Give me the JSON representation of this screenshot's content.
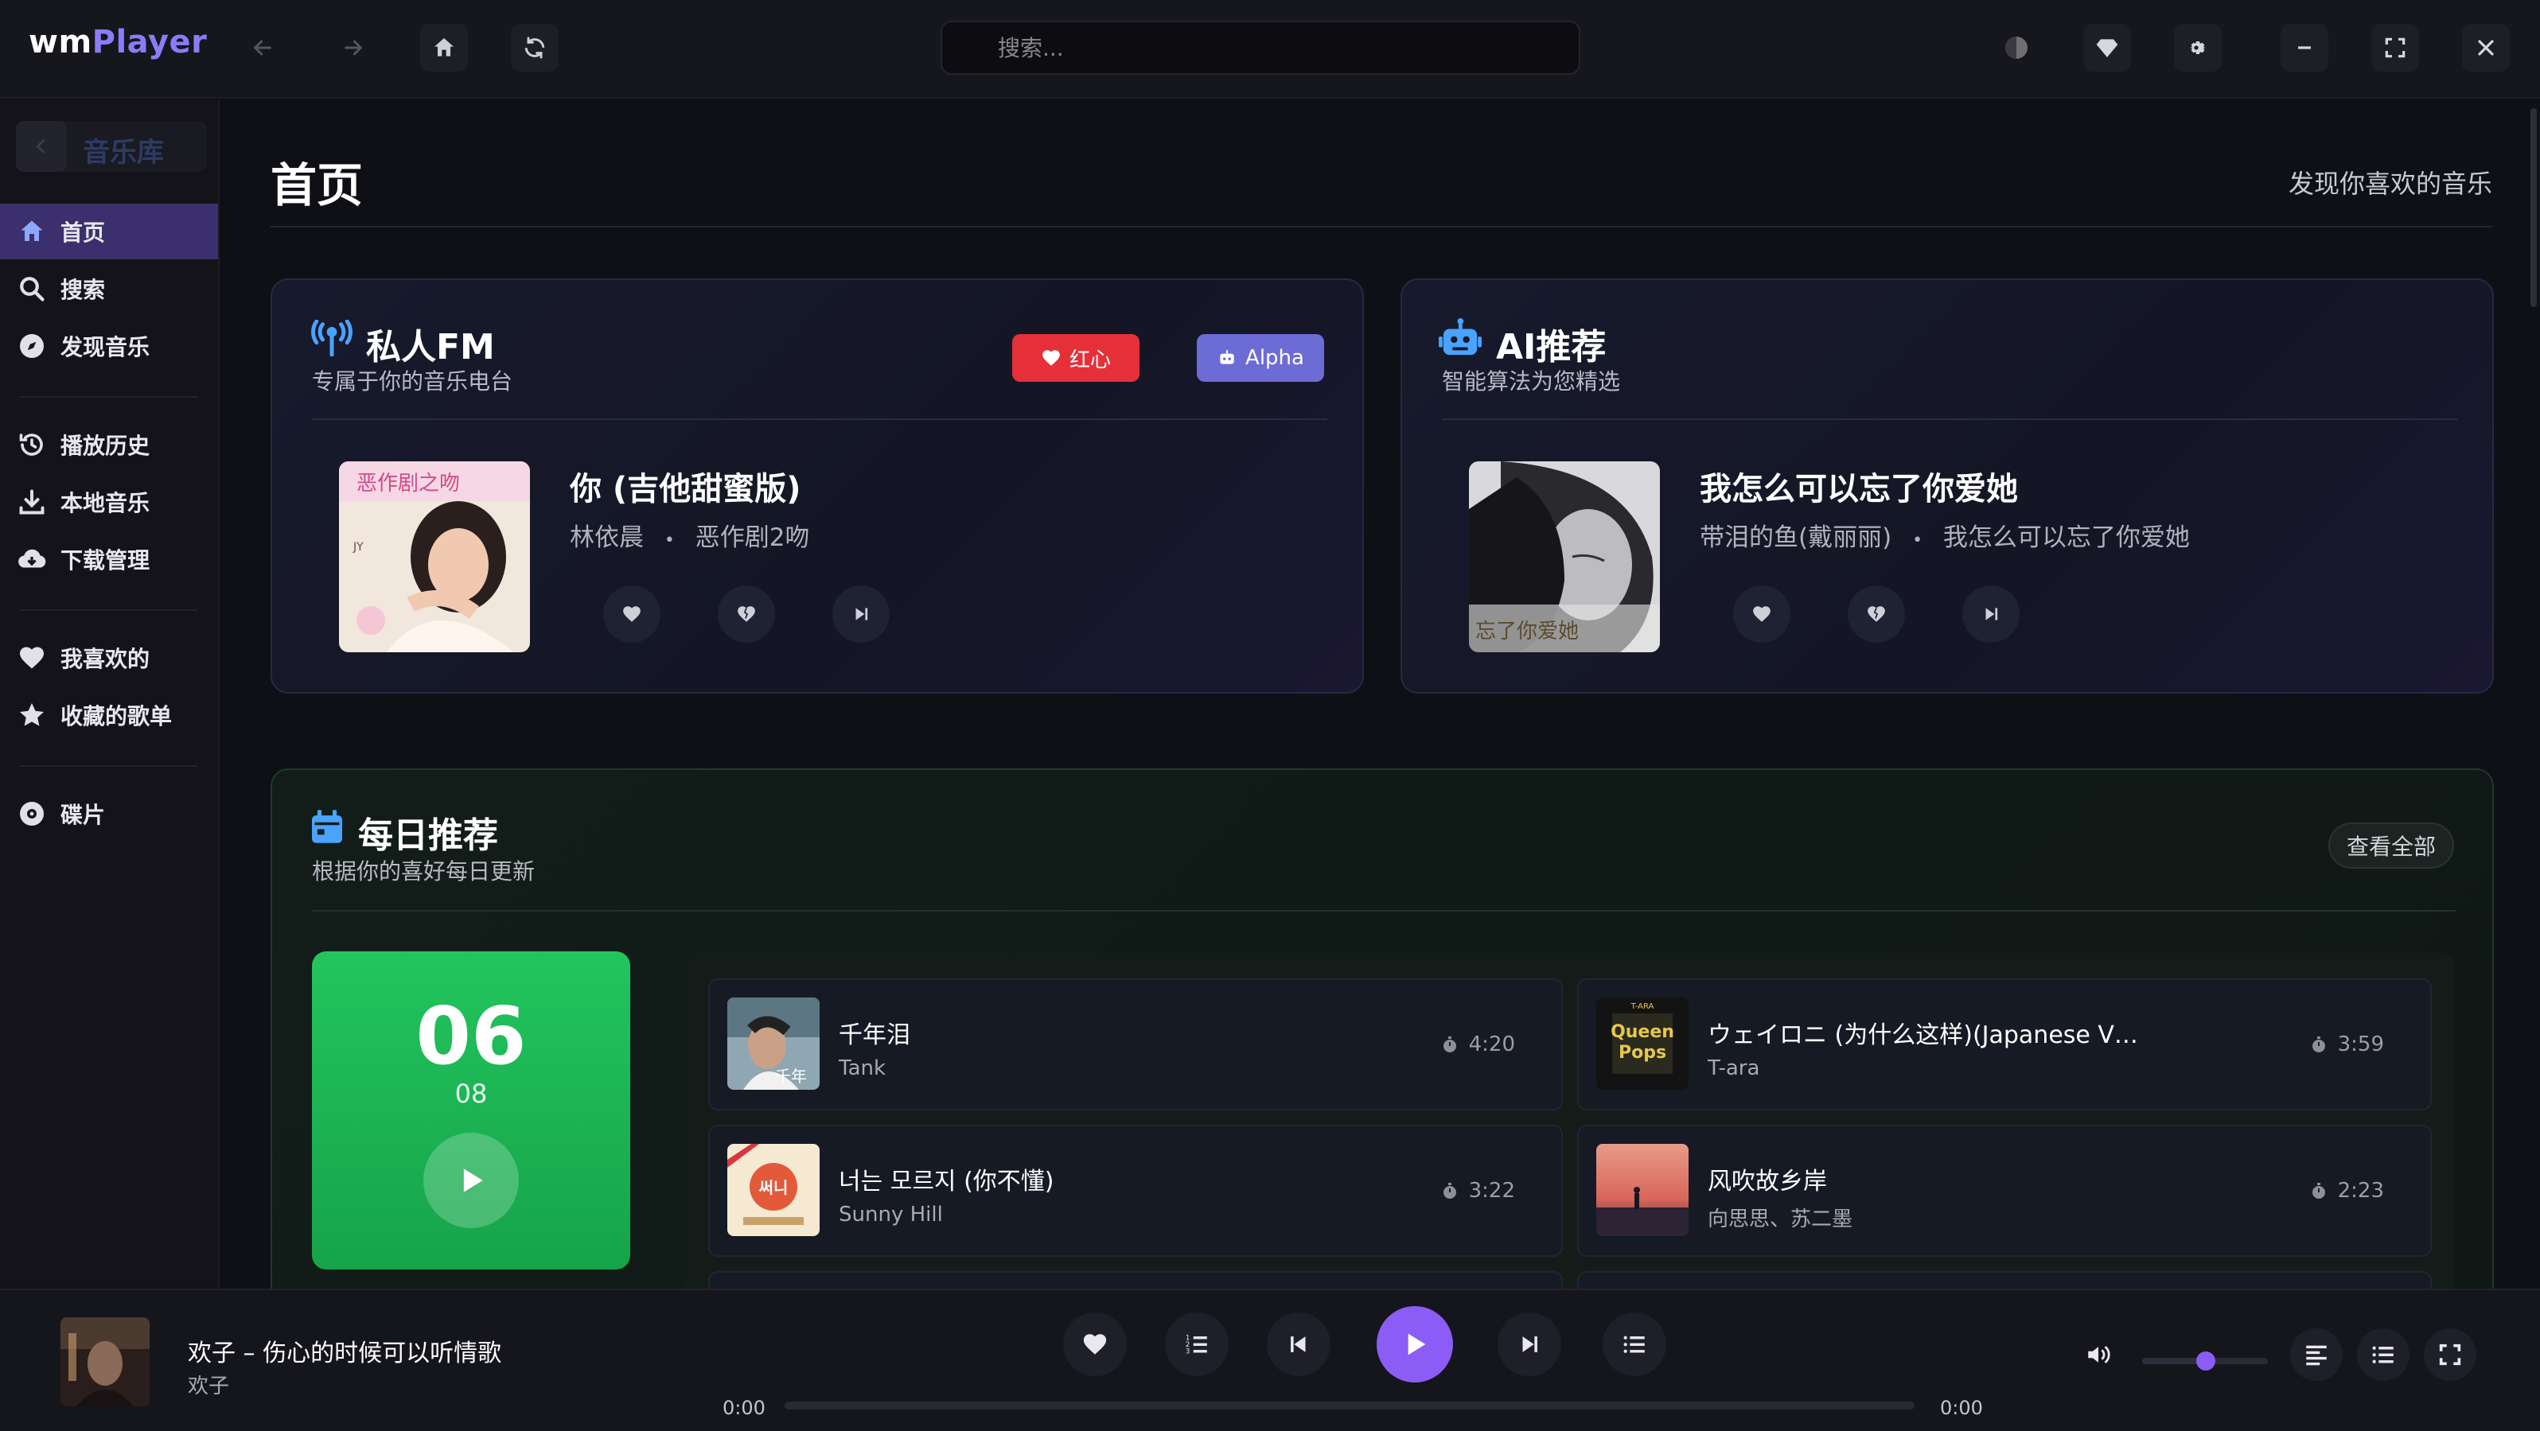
{
  "app": {
    "logo_main": "wm",
    "logo_accent": "Player"
  },
  "search": {
    "placeholder": "搜索..."
  },
  "sidebar": {
    "library_title": "音乐库",
    "items": [
      {
        "label": "首页",
        "icon": "home-icon"
      },
      {
        "label": "搜索",
        "icon": "search-icon"
      },
      {
        "label": "发现音乐",
        "icon": "compass-icon"
      },
      {
        "label": "播放历史",
        "icon": "history-icon"
      },
      {
        "label": "本地音乐",
        "icon": "download-icon"
      },
      {
        "label": "下载管理",
        "icon": "cloud-download-icon"
      },
      {
        "label": "我喜欢的",
        "icon": "heart-icon"
      },
      {
        "label": "收藏的歌单",
        "icon": "star-icon"
      },
      {
        "label": "碟片",
        "icon": "disc-icon"
      }
    ]
  },
  "main": {
    "title": "首页",
    "subtitle": "发现你喜欢的音乐"
  },
  "fm": {
    "title": "私人FM",
    "subtitle": "专属于你的音乐电台",
    "btn_red": "红心",
    "btn_alpha": "Alpha",
    "song_title": "你 (吉他甜蜜版)",
    "artist": "林依晨",
    "album": "恶作剧2吻",
    "separator": "•"
  },
  "ai": {
    "title": "AI推荐",
    "subtitle": "智能算法为您精选",
    "song_title": "我怎么可以忘了你爱她",
    "artist": "带泪的鱼(戴丽丽)",
    "album": "我怎么可以忘了你爱她",
    "separator": "•"
  },
  "daily": {
    "title": "每日推荐",
    "subtitle": "根据你的喜好每日更新",
    "see_all": "查看全部",
    "day": "06",
    "month": "08",
    "tracks": [
      {
        "title": "千年泪",
        "artist": "Tank",
        "duration": "4:20"
      },
      {
        "title": "ウェイロニ (为什么这样)(Japanese V…",
        "artist": "T-ara",
        "duration": "3:59"
      },
      {
        "title": "너는 모르지 (你不懂)",
        "artist": "Sunny Hill",
        "duration": "3:22"
      },
      {
        "title": "风吹故乡岸",
        "artist": "向思思、苏二墨",
        "duration": "2:23"
      }
    ]
  },
  "player": {
    "title": "欢子 – 伤心的时候可以听情歌",
    "artist": "欢子",
    "time_current": "0:00",
    "time_total": "0:00",
    "progress": 0,
    "volume": 0.5
  },
  "colors": {
    "accent": "#8b5cf6",
    "red_button": "#e5303a",
    "alpha_button": "#6d6bd6",
    "daily_green": "#22c55e",
    "fm_icon": "#4aa3ff"
  }
}
